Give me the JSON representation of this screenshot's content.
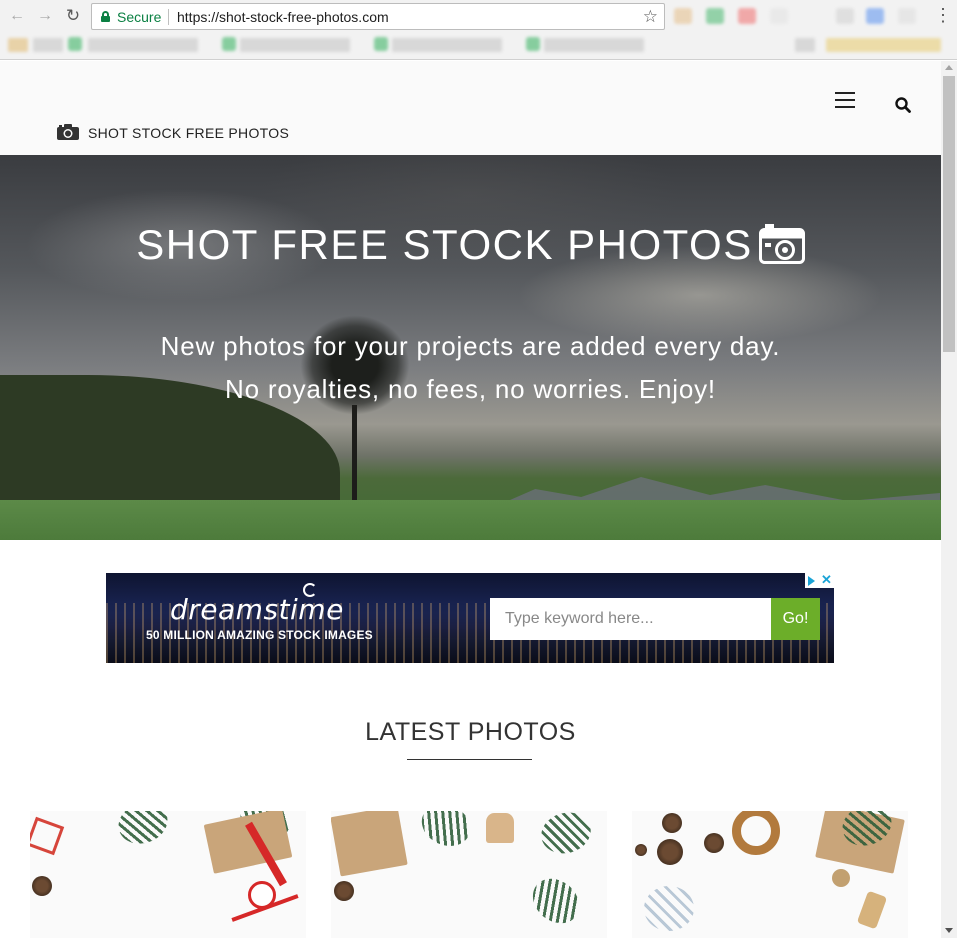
{
  "browser": {
    "secure_label": "Secure",
    "url": "https://shot-stock-free-photos.com",
    "back_icon": "arrow-left-icon",
    "forward_icon": "arrow-right-icon",
    "reload_icon": "reload-icon",
    "star_icon": "star-icon",
    "menu_icon": "vertical-dots-icon"
  },
  "header": {
    "logo_text": "SHOT STOCK FREE PHOTOS",
    "logo_icon": "camera-icon",
    "menu_icon": "hamburger-icon",
    "search_icon": "search-icon"
  },
  "hero": {
    "title": "SHOT FREE STOCK PHOTOS",
    "title_icon": "camera-icon",
    "subtitle_line1": "New photos for your projects are added every day.",
    "subtitle_line2": "No royalties, no fees, no worries. Enjoy!"
  },
  "ad": {
    "brand": "dreamstime",
    "tagline": "50 MILLION AMAZING STOCK IMAGES",
    "search_placeholder": "Type keyword here...",
    "go_label": "Go!",
    "brand_color": "#6cae29"
  },
  "latest": {
    "title": "LATEST PHOTOS",
    "photos": [
      {
        "subject": "christmas gift and fir branches"
      },
      {
        "subject": "kraft gift box, reindeer and fir branches"
      },
      {
        "subject": "pine cones, candle holder and gift"
      }
    ]
  }
}
